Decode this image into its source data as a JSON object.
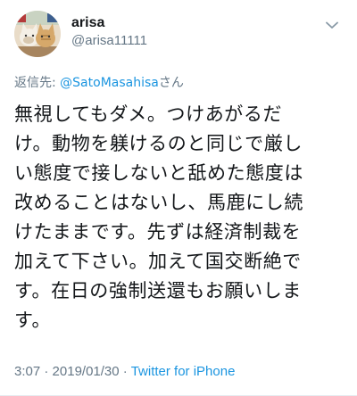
{
  "user": {
    "display_name": "arisa",
    "handle": "@arisa11111",
    "avatar_icon": "avatar-photo-cats-icon"
  },
  "more_icon": "chevron-down-icon",
  "reply": {
    "prefix": "返信先: ",
    "mention": "@SatoMasahisa",
    "suffix": "さん"
  },
  "tweet_lines": [
    "無視してもダメ。つけあがるだ",
    "け。動物を躾けるのと同じで厳し",
    "い態度で接しないと舐めた態度は",
    "改めることはないし、馬鹿にし続",
    "けたままです。先ずは経済制裁を",
    "加えて下さい。加えて国交断絶で",
    "す。在日の強制送還もお願いしま",
    "す。"
  ],
  "meta": {
    "time": "3:07",
    "separator_1": " · ",
    "date": "2019/01/30",
    "separator_2": " · ",
    "source": "Twitter for iPhone"
  },
  "colors": {
    "text": "#14171a",
    "secondary": "#657786",
    "link": "#1b95e0"
  }
}
